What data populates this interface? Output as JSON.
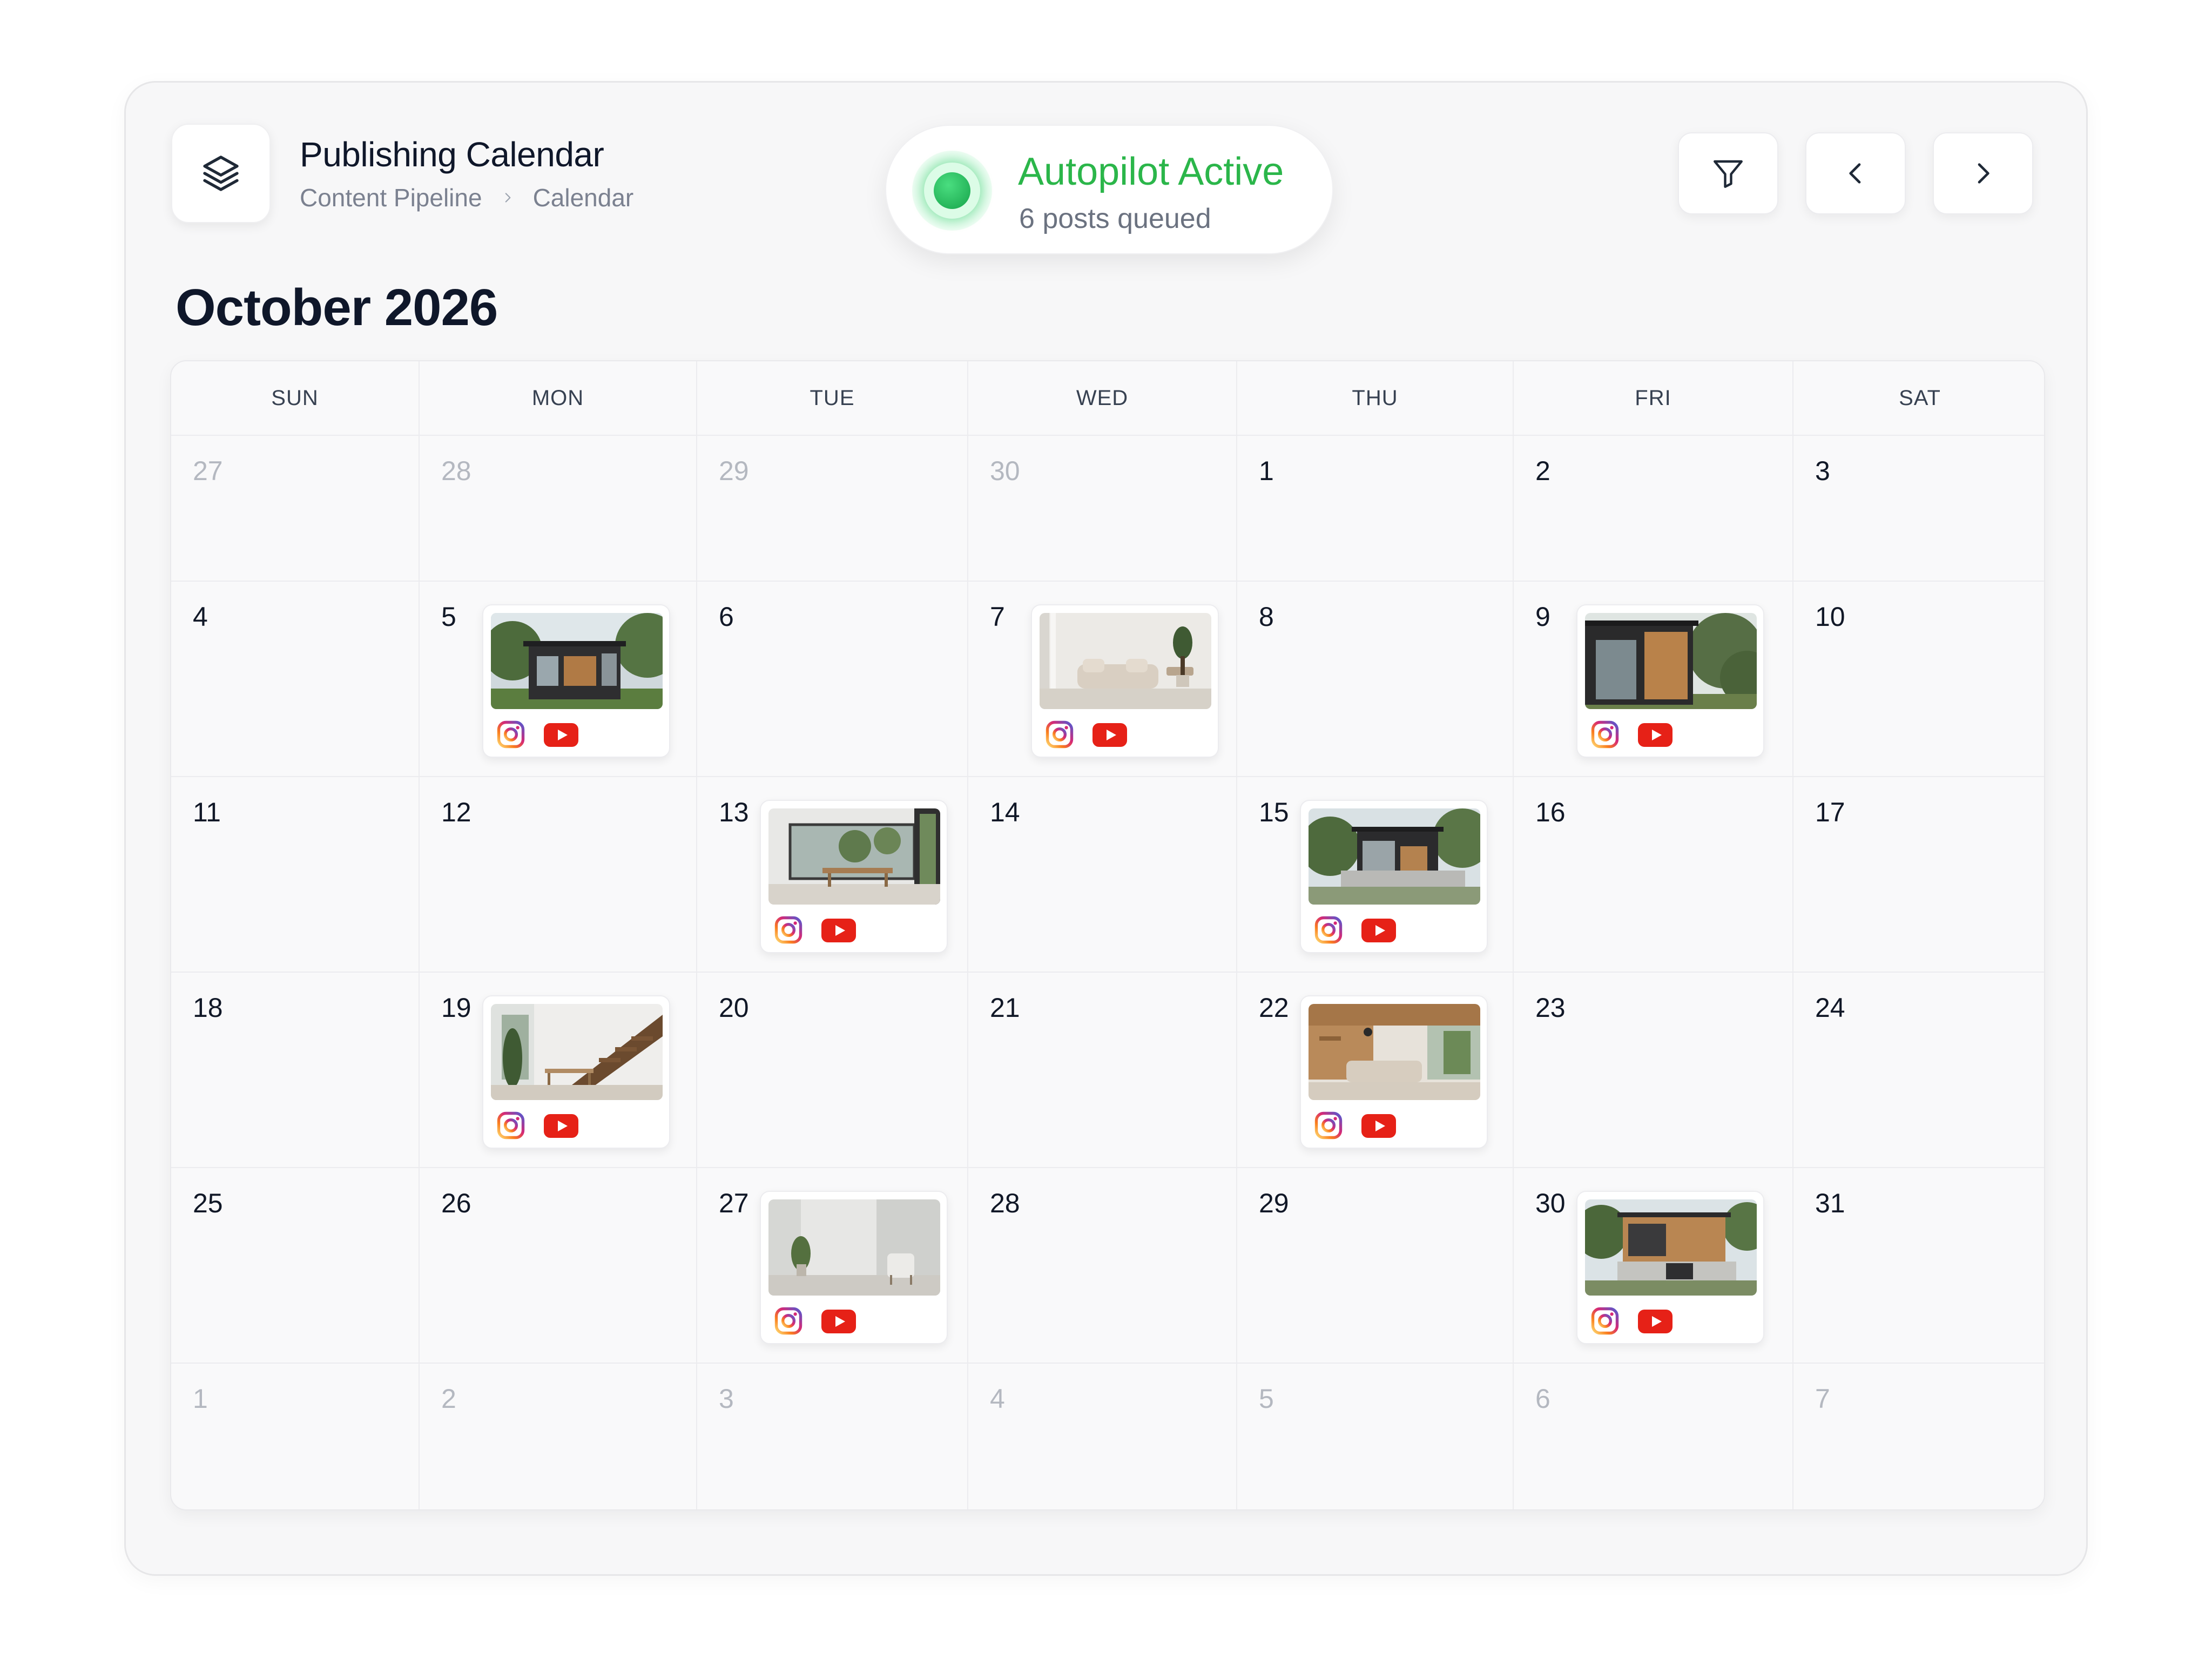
{
  "header": {
    "title": "Publishing Calendar",
    "breadcrumb": [
      "Content Pipeline",
      "Calendar"
    ],
    "logo_icon": "layers-icon"
  },
  "autopilot": {
    "status": "Autopilot Active",
    "subtitle": "6 posts queued",
    "color": "#2bb64a"
  },
  "toolbar": {
    "buttons": [
      {
        "icon": "filter-icon",
        "label": "Filter"
      },
      {
        "icon": "chevron-left-icon",
        "label": "Previous month"
      },
      {
        "icon": "chevron-right-icon",
        "label": "Next month"
      }
    ]
  },
  "calendar": {
    "month_label": "October 2026",
    "weekdays": [
      "SUN",
      "MON",
      "TUE",
      "WED",
      "THU",
      "FRI",
      "SAT"
    ],
    "weeks": [
      [
        {
          "day": "27",
          "muted": true
        },
        {
          "day": "28",
          "muted": true
        },
        {
          "day": "29",
          "muted": true
        },
        {
          "day": "30",
          "muted": true
        },
        {
          "day": "1"
        },
        {
          "day": "2"
        },
        {
          "day": "3"
        }
      ],
      [
        {
          "day": "4"
        },
        {
          "day": "5",
          "post": {
            "thumb": "modern-house-exterior",
            "platforms": [
              "instagram",
              "youtube"
            ]
          }
        },
        {
          "day": "6"
        },
        {
          "day": "7",
          "post": {
            "thumb": "living-room-sofa",
            "platforms": [
              "instagram",
              "youtube"
            ]
          }
        },
        {
          "day": "8"
        },
        {
          "day": "9",
          "post": {
            "thumb": "wood-cabin-facade",
            "platforms": [
              "instagram",
              "youtube"
            ]
          }
        },
        {
          "day": "10"
        }
      ],
      [
        {
          "day": "11"
        },
        {
          "day": "12"
        },
        {
          "day": "13",
          "post": {
            "thumb": "dining-room-windows",
            "platforms": [
              "instagram",
              "youtube"
            ]
          }
        },
        {
          "day": "14"
        },
        {
          "day": "15",
          "post": {
            "thumb": "modern-house-trees",
            "platforms": [
              "instagram",
              "youtube"
            ]
          }
        },
        {
          "day": "16"
        },
        {
          "day": "17"
        }
      ],
      [
        {
          "day": "18"
        },
        {
          "day": "19",
          "post": {
            "thumb": "staircase-interior",
            "platforms": [
              "instagram",
              "youtube"
            ]
          }
        },
        {
          "day": "20"
        },
        {
          "day": "21"
        },
        {
          "day": "22",
          "post": {
            "thumb": "wood-living-room",
            "platforms": [
              "instagram",
              "youtube"
            ]
          }
        },
        {
          "day": "23"
        },
        {
          "day": "24"
        }
      ],
      [
        {
          "day": "25"
        },
        {
          "day": "26"
        },
        {
          "day": "27",
          "post": {
            "thumb": "minimal-room-chair",
            "platforms": [
              "instagram",
              "youtube"
            ]
          }
        },
        {
          "day": "28"
        },
        {
          "day": "29"
        },
        {
          "day": "30",
          "post": {
            "thumb": "house-wood-cladding",
            "platforms": [
              "instagram",
              "youtube"
            ]
          }
        },
        {
          "day": "31"
        }
      ],
      [
        {
          "day": "1",
          "muted": true
        },
        {
          "day": "2",
          "muted": true
        },
        {
          "day": "3",
          "muted": true
        },
        {
          "day": "4",
          "muted": true
        },
        {
          "day": "5",
          "muted": true
        },
        {
          "day": "6",
          "muted": true
        },
        {
          "day": "7",
          "muted": true
        }
      ]
    ]
  },
  "colors": {
    "accent_green": "#2bb64a",
    "youtube_red": "#e62117",
    "muted_text": "#b4b8c0"
  }
}
